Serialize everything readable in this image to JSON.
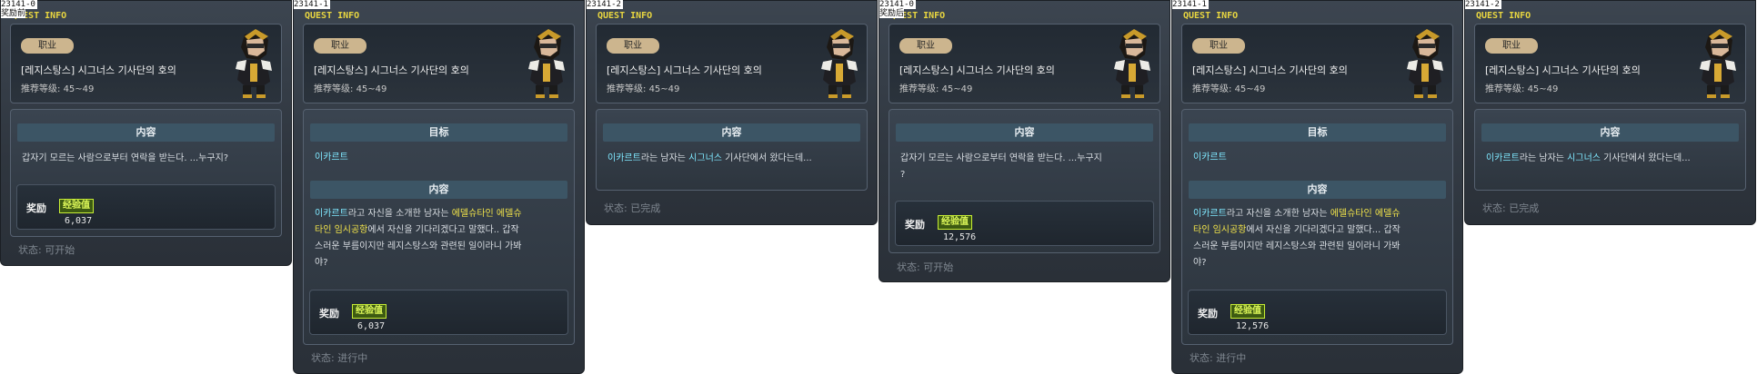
{
  "common": {
    "quest_info": "QUEST INFO",
    "job_label": "职业",
    "quest_name": "[레지스탕스] 시그너스 기사단의 호의",
    "level_label": "推荐等级:",
    "level_range": "45~49",
    "reward_label": "奖励",
    "exp_label": "经验值",
    "section_content": "内容",
    "section_target": "目标"
  },
  "panels": [
    {
      "id": "23141-0",
      "sub": "奖励前",
      "content_line1": "갑자기 모르는 사람으로부터 연락을 받는다. ...누구지?",
      "exp": "6,037",
      "status": "状态:  可开始"
    },
    {
      "id": "23141-1",
      "target": "이카르트",
      "content_a_hl": "이카르트",
      "content_a": "라고 자신을 소개한 남자는 ",
      "content_b_hl": "에델슈타인 에델슈",
      "content_c_hl": "타인 임시공항",
      "content_c": "에서 자신을 기다리겠다고 말했다.. 갑작",
      "content_d": "스러운 부름이지만 레지스탕스와 관련된 일이라니 가봐",
      "content_e": "야?",
      "exp": "6,037",
      "status": "状态:  进行中"
    },
    {
      "id": "23141-2",
      "content_hl1": "이카르트",
      "content_mid": "라는 남자는 ",
      "content_hl2": "시그너스",
      "content_end": " 기사단에서 왔다는데...",
      "status": "状态:  已完成"
    },
    {
      "id": "23141-0",
      "sub": "奖励后",
      "content_line1": "갑자기 모르는 사람으로부터 연락을 받는다. ...누구지",
      "content_line2": "?",
      "exp": "12,576",
      "status": "状态:  可开始"
    },
    {
      "id": "23141-1",
      "target": "이카르트",
      "content_a_hl": "이카르트",
      "content_a": "라고 자신을 소개한 남자는 ",
      "content_b_hl": "에델슈타인 에델슈",
      "content_c_hl": "타인 임시공항",
      "content_c": "에서 자신을 기다리겠다고 말했다... 갑작",
      "content_d": "스러운 부름이지만 레지스탕스와 관련된 일이라니 가봐",
      "content_e": "야?",
      "exp": "12,576",
      "status": "状态:  进行中"
    },
    {
      "id": "23141-2",
      "content_hl1": "이카르트",
      "content_mid": "라는 남자는 ",
      "content_hl2": "시그너스",
      "content_end": " 기사단에서 왔다는데...",
      "status": "状态:  已完成"
    }
  ]
}
